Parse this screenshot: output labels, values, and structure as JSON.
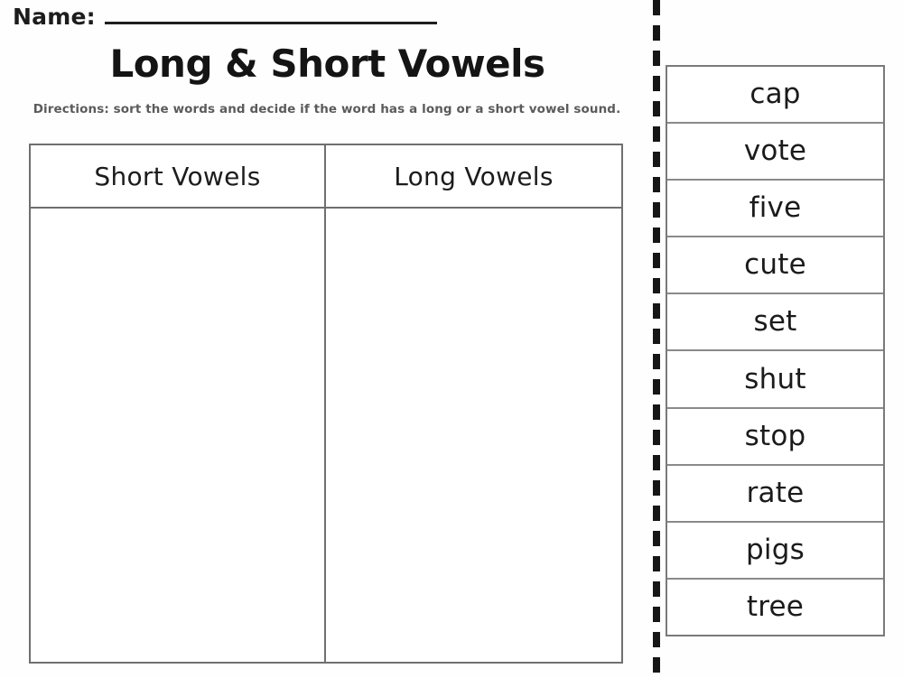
{
  "worksheet": {
    "name_field": {
      "label": "Name:",
      "value": ""
    },
    "title": "Long & Short Vowels",
    "directions": "Directions: sort the words and decide if the word has a long or a short vowel sound."
  },
  "sort_table": {
    "columns": [
      {
        "header": "Short Vowels",
        "entries": []
      },
      {
        "header": "Long Vowels",
        "entries": []
      }
    ]
  },
  "word_bank": {
    "words": [
      "cap",
      "vote",
      "five",
      "cute",
      "set",
      "shut",
      "stop",
      "rate",
      "pigs",
      "tree"
    ]
  },
  "colors": {
    "page_background": "#fefefe",
    "ink": "#1c1c1c",
    "directions_text": "#5b5b5b",
    "table_border": "#6f6f6f",
    "word_bank_border": "#7a7a7a",
    "cut_line": "#161616"
  }
}
